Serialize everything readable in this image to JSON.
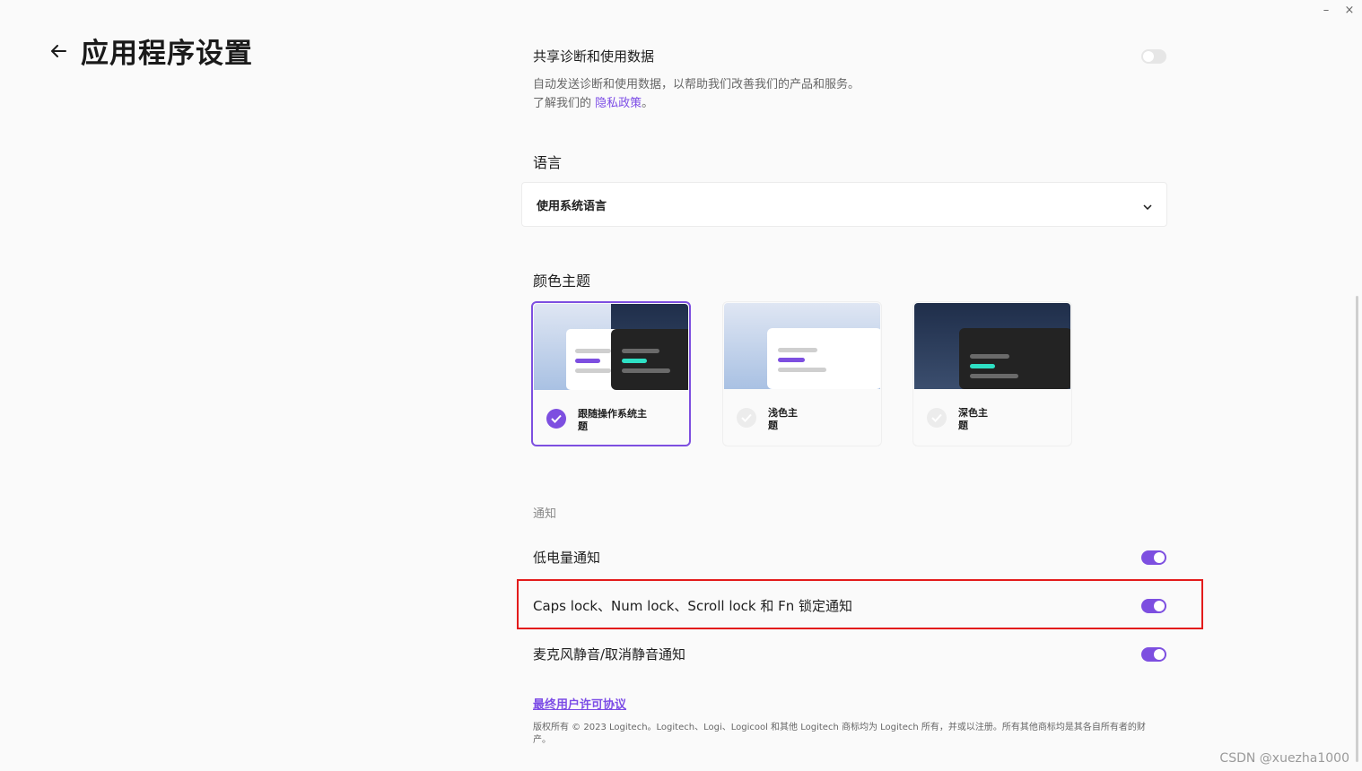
{
  "window": {
    "minimize": "–",
    "close": "×"
  },
  "header": {
    "title": "应用程序设置",
    "back_icon": "arrow-left-icon"
  },
  "diagnostics": {
    "title": "共享诊断和使用数据",
    "desc_line1": "自动发送诊断和使用数据，以帮助我们改善我们的产品和服务。",
    "desc_line2_prefix": "了解我们的",
    "privacy_link": "隐私政策",
    "desc_line2_suffix": "。",
    "enabled": false
  },
  "language": {
    "title": "语言",
    "selected": "使用系统语言",
    "chevron_icon": "chevron-down-icon"
  },
  "theme": {
    "title": "颜色主题",
    "options": [
      {
        "label": "跟随操作系统主题",
        "selected": true
      },
      {
        "label": "浅色主题",
        "selected": false
      },
      {
        "label": "深色主题",
        "selected": false
      }
    ]
  },
  "notifications": {
    "section_label": "通知",
    "items": [
      {
        "label": "低电量通知",
        "enabled": true
      },
      {
        "label": "Caps lock、Num lock、Scroll lock 和 Fn 锁定通知",
        "enabled": true
      },
      {
        "label": "麦克风静音/取消静音通知",
        "enabled": true
      }
    ]
  },
  "footer": {
    "eula_link": "最终用户许可协议",
    "copyright": "版权所有 © 2023 Logitech。Logitech、Logi、Logicool 和其他 Logitech 商标均为 Logitech 所有，并或以注册。所有其他商标均是其各自所有者的财产。"
  },
  "watermark": "CSDN @xuezha1000",
  "colors": {
    "accent": "#7d4fe0",
    "highlight": "#e31b1b"
  }
}
